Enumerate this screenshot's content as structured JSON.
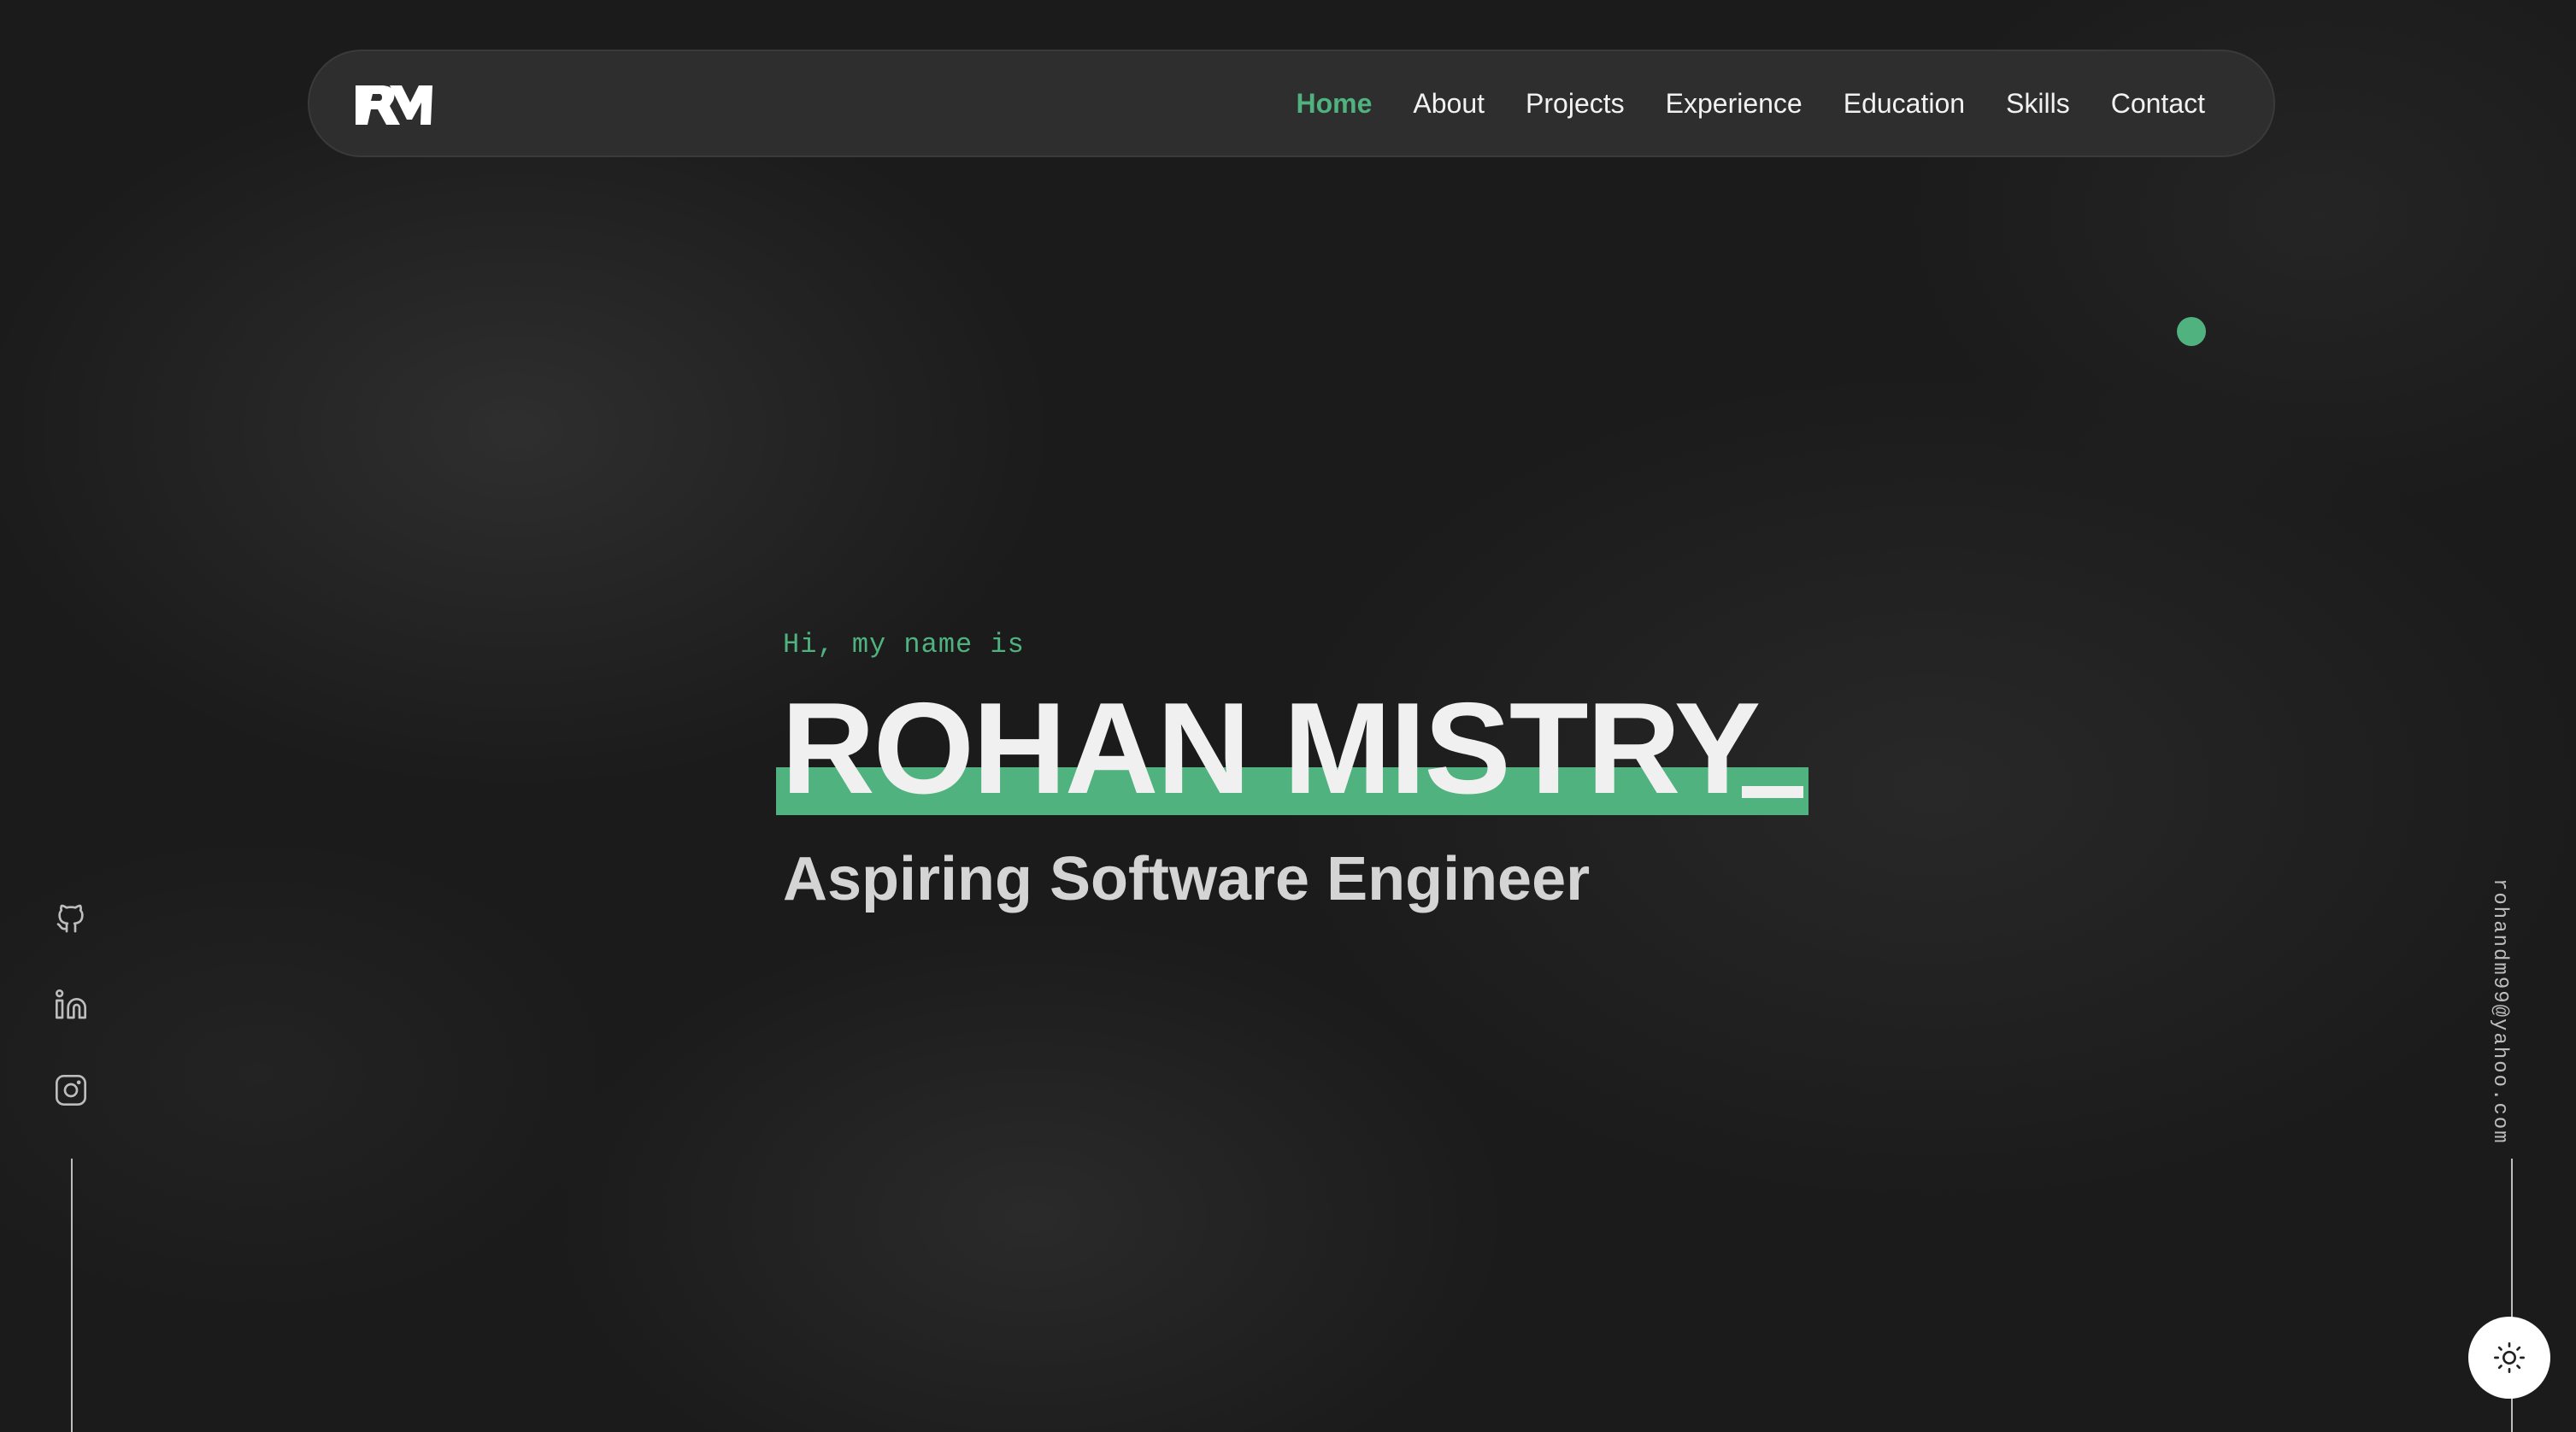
{
  "nav": {
    "logo_icon": "rm-monogram-logo",
    "links": [
      {
        "label": "Home",
        "active": true
      },
      {
        "label": "About",
        "active": false
      },
      {
        "label": "Projects",
        "active": false
      },
      {
        "label": "Experience",
        "active": false
      },
      {
        "label": "Education",
        "active": false
      },
      {
        "label": "Skills",
        "active": false
      },
      {
        "label": "Contact",
        "active": false
      }
    ]
  },
  "hero": {
    "greeting": "Hi, my name is",
    "name": "ROHAN MISTRY",
    "subtitle": "Aspiring Software Engineer"
  },
  "socials": [
    {
      "icon": "github-icon"
    },
    {
      "icon": "linkedin-icon"
    },
    {
      "icon": "instagram-icon"
    }
  ],
  "email": "rohandm99@yahoo.com",
  "theme_toggle_icon": "sun-icon",
  "colors": {
    "accent": "#4fb27f",
    "background": "#1b1b1b",
    "nav_background": "#303030",
    "text": "#f0f0f0"
  }
}
